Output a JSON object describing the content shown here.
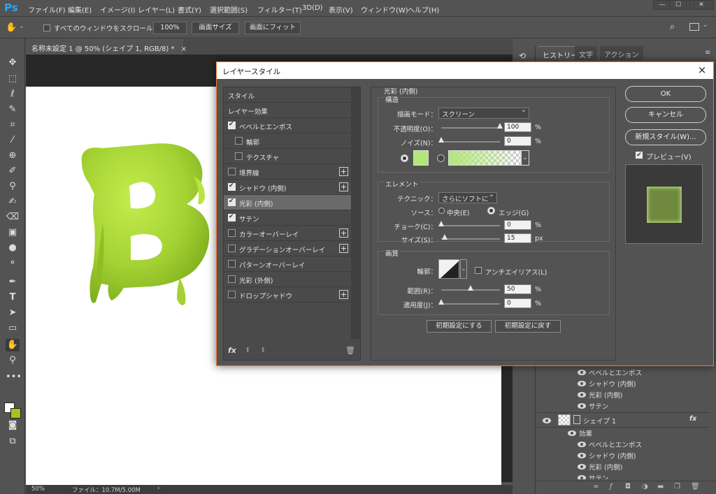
{
  "app": {
    "logo": "Ps"
  },
  "menubar": {
    "items": [
      "ファイル(F)",
      "編集(E)",
      "イメージ(I)",
      "レイヤー(L)",
      "書式(Y)",
      "選択範囲(S)",
      "フィルター(T)",
      "3D(D)",
      "表示(V)",
      "ウィンドウ(W)",
      "ヘルプ(H)"
    ]
  },
  "options": {
    "scroll_all_label": "すべてのウィンドウをスクロール",
    "zoom_value": "100%",
    "fit_screen": "画面サイズ",
    "fill_screen": "画面にフィット"
  },
  "document": {
    "tab_title": "名称未設定 1 @ 50% (シェイプ 1, RGB/8) *",
    "tab_close": "×",
    "canvas_letter": "B",
    "canvas_letter_color": "#a4d233"
  },
  "status": {
    "zoom": "50%",
    "file_info": "ファイル：10.7M/5.00M"
  },
  "right_panel": {
    "tabs": [
      "ヒストリー",
      "文字",
      "アクション"
    ],
    "layers_upper": [
      "ベベルとエンボス",
      "シャドウ (内側)",
      "光彩 (内側)",
      "サテン"
    ],
    "shape_layer_name": "シェイプ 1",
    "fx_label": "fx",
    "effects_label": "効果",
    "layers_lower": [
      "ベベルとエンボス",
      "シャドウ (内側)",
      "光彩 (内側)",
      "サテン"
    ]
  },
  "dialog": {
    "title": "レイヤースタイル",
    "close": "×",
    "styles_header": "スタイル",
    "blend_header": "レイヤー効果",
    "style_items": [
      {
        "label": "ベベルとエンボス",
        "checked": true,
        "plus": false,
        "indent": false
      },
      {
        "label": "輪郭",
        "checked": false,
        "plus": false,
        "indent": true
      },
      {
        "label": "テクスチャ",
        "checked": false,
        "plus": false,
        "indent": true
      },
      {
        "label": "境界線",
        "checked": false,
        "plus": true,
        "indent": false
      },
      {
        "label": "シャドウ (内側)",
        "checked": true,
        "plus": true,
        "indent": false
      },
      {
        "label": "光彩 (内側)",
        "checked": true,
        "plus": false,
        "indent": false,
        "selected": true
      },
      {
        "label": "サテン",
        "checked": true,
        "plus": false,
        "indent": false
      },
      {
        "label": "カラーオーバーレイ",
        "checked": false,
        "plus": true,
        "indent": false
      },
      {
        "label": "グラデーションオーバーレイ",
        "checked": false,
        "plus": true,
        "indent": false
      },
      {
        "label": "パターンオーバーレイ",
        "checked": false,
        "plus": false,
        "indent": false
      },
      {
        "label": "光彩 (外側)",
        "checked": false,
        "plus": false,
        "indent": false
      },
      {
        "label": "ドロップシャドウ",
        "checked": false,
        "plus": true,
        "indent": false
      }
    ],
    "fx_label": "fx",
    "section_title": "光彩 (内側)",
    "structure": {
      "title": "構造",
      "blend_mode_label": "描画モード：",
      "blend_mode": "スクリーン",
      "opacity_label": "不透明度(O)：",
      "opacity": "100",
      "opacity_level": 1.0,
      "noise_label": "ノイズ(N)：",
      "noise": "0",
      "noise_level": 0.0,
      "percent": "%",
      "glow_color": "#b2e67a"
    },
    "elements": {
      "title": "エレメント",
      "technique_label": "テクニック：",
      "technique": "さらにソフトに",
      "source_label": "ソース：",
      "center_label": "中央(E)",
      "edge_label": "エッジ(G)",
      "choke_label": "チョーク(C)：",
      "choke": "0",
      "choke_level": 0.0,
      "size_label": "サイズ(S)：",
      "size": "15",
      "size_level": 0.06,
      "px": "px"
    },
    "quality": {
      "title": "画質",
      "contour_label": "輪郭：",
      "antialias_label": "アンチエイリアス(L)",
      "range_label": "範囲(R)：",
      "range": "50",
      "range_level": 0.5,
      "jitter_label": "適用度(J)：",
      "jitter": "0",
      "jitter_level": 0.0
    },
    "make_default": "初期設定にする",
    "reset_default": "初期設定に戻す",
    "ok": "OK",
    "cancel": "キャンセル",
    "new_style": "新規スタイル(W)...",
    "preview_label": "プレビュー(V)",
    "preview_color": "#6f8a3e"
  }
}
